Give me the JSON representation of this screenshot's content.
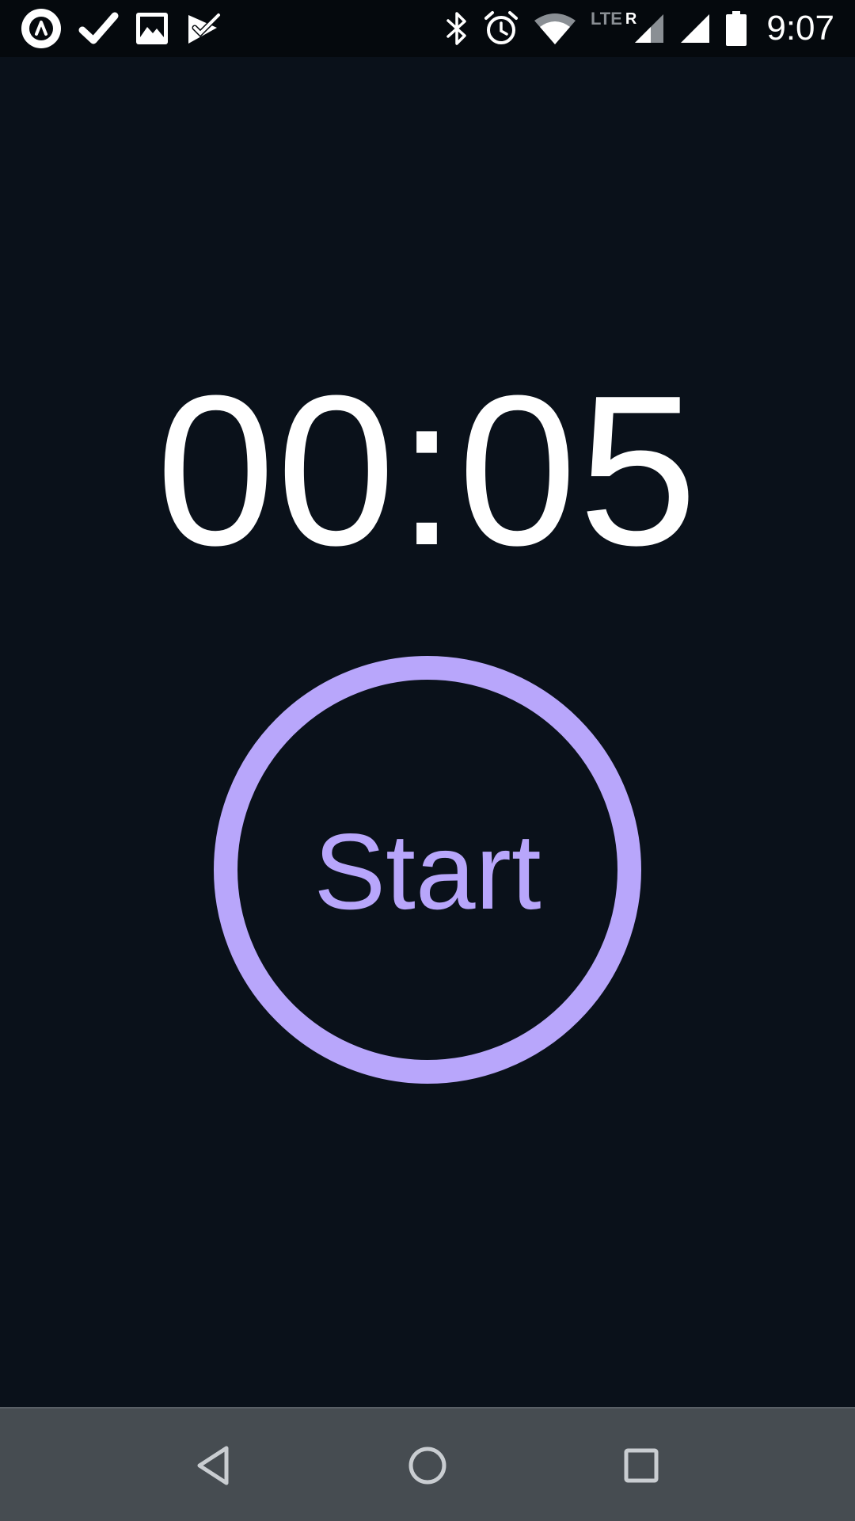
{
  "status_bar": {
    "time": "9:07",
    "network_label": "LTE",
    "roaming_label": "R",
    "notification_icons": [
      "app-logo-icon",
      "check-icon",
      "image-icon",
      "task-check-icon"
    ],
    "system_icons": [
      "bluetooth-icon",
      "alarm-icon",
      "wifi-icon",
      "cell-signal-roaming-icon",
      "cell-signal-icon",
      "battery-icon"
    ]
  },
  "timer": {
    "display": "00:05"
  },
  "start_button": {
    "label": "Start",
    "accent_color": "#b8a6fb"
  },
  "navigation_bar": {
    "buttons": [
      "back-icon",
      "home-icon",
      "recents-icon"
    ]
  },
  "colors": {
    "background": "#0a111a",
    "status_bar": "#05090d",
    "nav_bar": "#464c51",
    "text": "#ffffff"
  }
}
